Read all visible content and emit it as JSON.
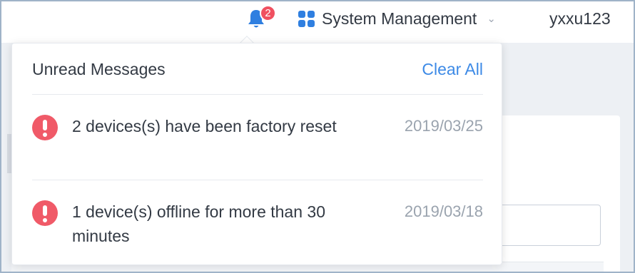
{
  "topbar": {
    "notifications": {
      "icon": "bell-icon",
      "badge_count": "2"
    },
    "system_menu": {
      "icon": "grid-icon",
      "label": "System Management"
    },
    "username": "yxxu123"
  },
  "popover": {
    "title": "Unread Messages",
    "clear_all_label": "Clear All",
    "messages": [
      {
        "icon": "alert-icon",
        "text": "2 devices(s) have been factory reset",
        "date": "2019/03/25"
      },
      {
        "icon": "alert-icon",
        "text": "1 device(s) offline for more than 30 minutes",
        "date": "2019/03/18"
      }
    ]
  },
  "colors": {
    "accent": "#3d8ae6",
    "alert": "#f05a68",
    "badge": "#f05060",
    "text": "#333a44",
    "muted": "#9aa3ae"
  }
}
